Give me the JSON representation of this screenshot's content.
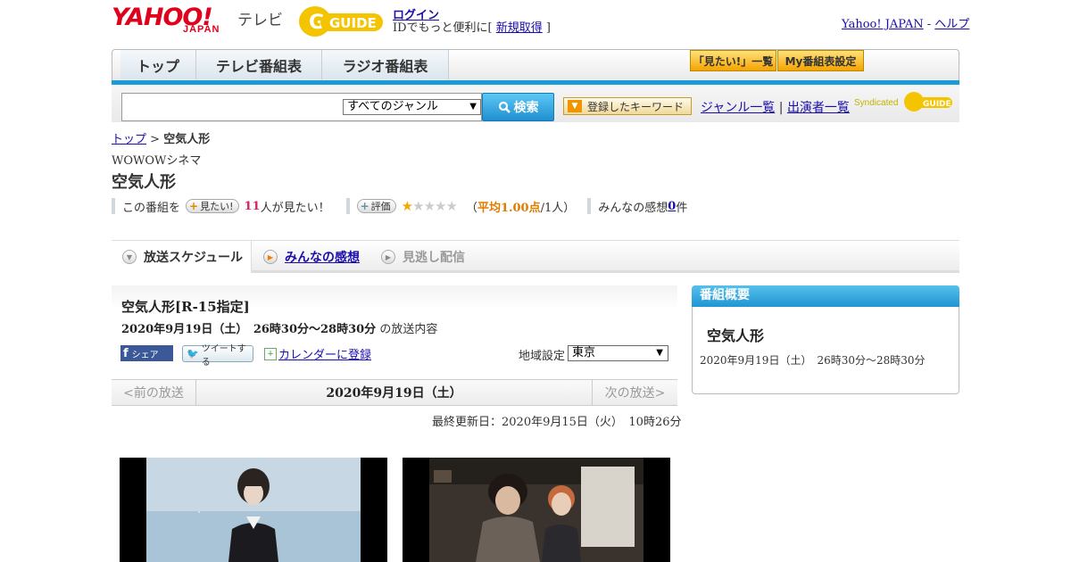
{
  "header": {
    "logo_text": "YAHOO!",
    "logo_sub": "JAPAN",
    "tv_label": "テレビ",
    "gguide_text": "GUIDE",
    "login_link": "ログイン",
    "id_prefix": "IDでもっと便利に[ ",
    "signup_link": "新規取得",
    "id_suffix": " ]",
    "yahoo_japan_link": "Yahoo! JAPAN",
    "separator": " - ",
    "help_link": "ヘルプ"
  },
  "nav": {
    "tabs": [
      "トップ",
      "テレビ番組表",
      "ラジオ番組表"
    ],
    "mitai_button": "「見たい!」一覧",
    "my_program_button": "My番組表設定"
  },
  "search": {
    "genre_selected": "すべてのジャンル",
    "search_button": "検索",
    "keyword_button": "登録したキーワード",
    "genre_list_link": "ジャンル一覧",
    "link_separator": " | ",
    "performer_list_link": "出演者一覧",
    "syndicated_label": "Syndicated"
  },
  "breadcrumb": {
    "top_link": "トップ",
    "separator": " > ",
    "current": "空気人形"
  },
  "program": {
    "channel": "WOWOWシネマ",
    "title": "空気人形",
    "want_prefix": "この番組を",
    "want_button": "見たい!",
    "want_count": "11",
    "want_suffix": "人が見たい！",
    "rating_button": "評価",
    "rating_value": 1,
    "rating_max": 5,
    "rating_open": "（",
    "rating_avg": "平均1.00点",
    "rating_count": "/1人）",
    "impressions_label": "みんなの感想 ",
    "impressions_count": "0",
    "impressions_suffix": "件"
  },
  "tabs": {
    "schedule": "放送スケジュール",
    "impressions": "みんなの感想",
    "missed": "見逃し配信"
  },
  "broadcast": {
    "title": "空気人形[R-15指定]",
    "datetime": "2020年9月19日（土）　26時30分～28時30分",
    "datetime_suffix": " の放送内容",
    "share_fb": "シェア",
    "share_tw": "ツイートする",
    "calendar_link": "カレンダーに登録",
    "region_label": "地域設定",
    "region_value": "東京",
    "prev_label": "<前の放送",
    "current_date": "2020年9月19日（土）",
    "next_label": "次の放送>",
    "updated": "最終更新日：2020年9月15日（火）　10時26分"
  },
  "sidebar": {
    "header": "番組概要",
    "title": "空気人形",
    "datetime": "2020年9月19日（土）　26時30分～28時30分"
  },
  "colors": {
    "brand_red": "#e0001b",
    "accent_blue": "#1a9ad6",
    "gguide_yellow": "#f5c400"
  }
}
